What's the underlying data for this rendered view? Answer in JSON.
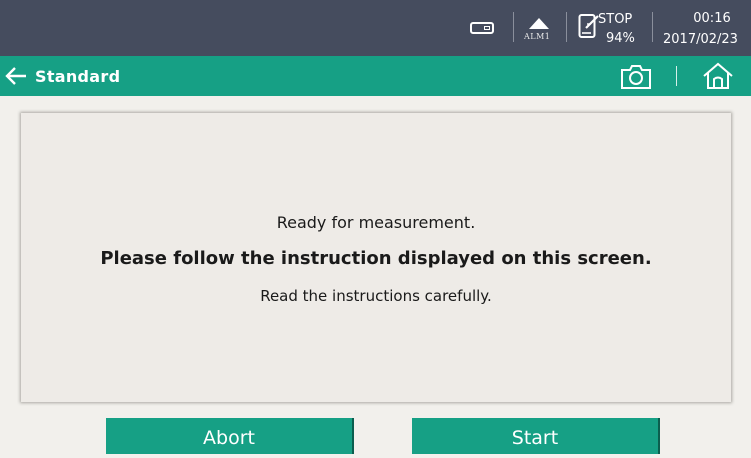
{
  "status_bar": {
    "usb_icon": "usb-drive-icon",
    "alarm_icon": "alarm-triangle-icon",
    "alarm_label": "ALM1",
    "edit_icon": "edit-note-icon",
    "run_state": "STOP",
    "battery": "94%",
    "time": "00:16",
    "date": "2017/02/23"
  },
  "header": {
    "back_icon": "arrow-left-icon",
    "title": "Standard",
    "camera_icon": "camera-icon",
    "home_icon": "home-icon"
  },
  "message": {
    "line1": "Ready for measurement.",
    "line2": "Please follow the instruction displayed on this screen.",
    "line3": "Read the instructions carefully."
  },
  "buttons": {
    "abort_label": "Abort",
    "start_label": "Start"
  },
  "colors": {
    "status_bar_bg": "#454c5e",
    "accent_green": "#16a085",
    "panel_bg": "#eeebe7",
    "page_bg": "#f2f0ec"
  }
}
